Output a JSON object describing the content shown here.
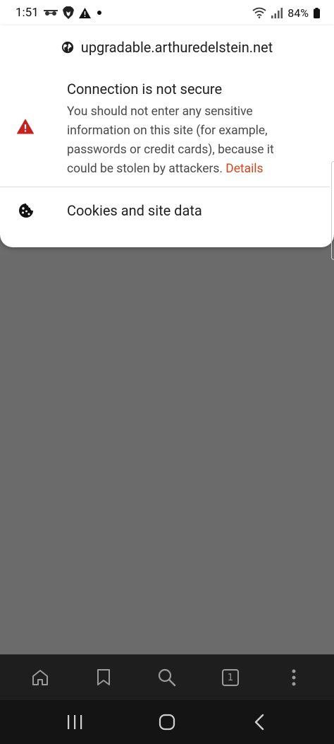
{
  "status_bar": {
    "time": "1:51",
    "battery_percent": "84%",
    "left_icons": [
      "incognito-icon",
      "brave-lion-icon",
      "warning-icon",
      "dot-icon"
    ],
    "right_icons": [
      "wifi-icon",
      "signal-icon",
      "battery-icon"
    ]
  },
  "site_info": {
    "domain": "upgradable.arthuredelstein.net",
    "domain_icon": "globe-icon",
    "connection": {
      "icon": "warning-triangle-icon",
      "icon_color": "#c5221f",
      "title": "Connection is not secure",
      "description": "You should not enter any sensitive information on this site (for example, passwords or credit cards), because it could be stolen by attackers.",
      "details_link": "Details",
      "link_color": "#d8431e"
    },
    "cookies": {
      "icon": "cookie-icon",
      "label": "Cookies and site data"
    }
  },
  "toolbar": {
    "items": [
      "home-icon",
      "bookmark-icon",
      "search-icon",
      "tabs-icon",
      "more-icon"
    ],
    "tab_count": "1"
  },
  "nav_bar": {
    "items": [
      "recents-icon",
      "home-circle-icon",
      "back-icon"
    ]
  }
}
